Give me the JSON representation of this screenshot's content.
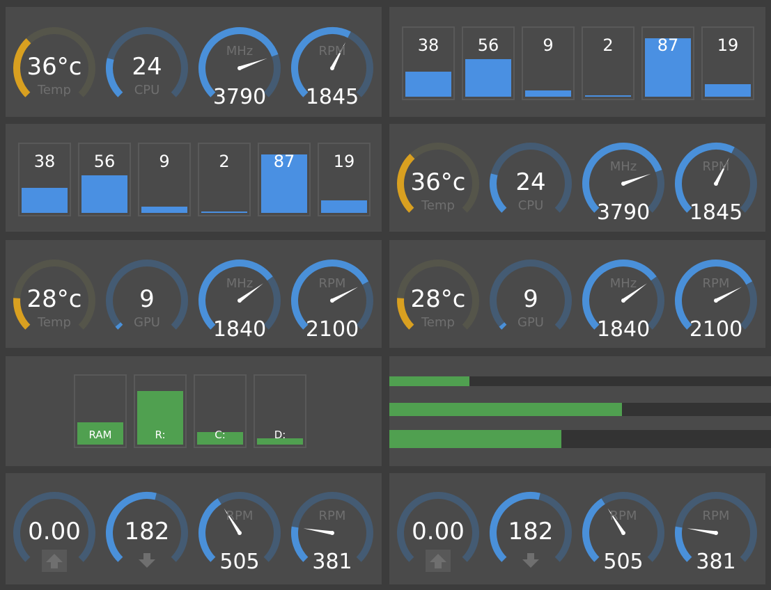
{
  "colors": {
    "arc_blue": "#4a90d9",
    "arc_track": "#445b73",
    "arc_temp": "#d9a020",
    "arc_temp_track": "#55554a",
    "bar_blue": "#4a90e2",
    "bar_green": "#50a050",
    "track_dark": "#333333",
    "panel_bg": "#4a4a4a",
    "page_bg": "#3c3c3c"
  },
  "cpu_panel": {
    "temp": {
      "value": "36°c",
      "label": "Temp",
      "level": 0.34
    },
    "load": {
      "value": "24",
      "label": "CPU",
      "level": 0.22
    },
    "clock": {
      "value": "3790",
      "label": "MHz",
      "level": 0.76
    },
    "fan": {
      "value": "1845",
      "label": "RPM",
      "level": 0.6
    }
  },
  "gpu_panel": {
    "temp": {
      "value": "28°c",
      "label": "Temp",
      "level": 0.18
    },
    "load": {
      "value": "9",
      "label": "GPU",
      "level": 0.02
    },
    "clock": {
      "value": "1840",
      "label": "MHz",
      "level": 0.7
    },
    "fan": {
      "value": "2100",
      "label": "RPM",
      "level": 0.73
    }
  },
  "core_bars": [
    {
      "value": "38",
      "level": 0.38
    },
    {
      "value": "56",
      "level": 0.56
    },
    {
      "value": "9",
      "level": 0.09
    },
    {
      "value": "2",
      "level": 0.02
    },
    {
      "value": "87",
      "level": 0.87
    },
    {
      "value": "19",
      "level": 0.19
    }
  ],
  "memory_bars": [
    {
      "label": "RAM",
      "level": 0.33
    },
    {
      "label": "R:",
      "level": 0.8
    },
    {
      "label": "C:",
      "level": 0.19
    },
    {
      "label": "D:",
      "level": 0.09
    }
  ],
  "disk_bars": [
    {
      "level": 0.21
    },
    {
      "level": 0.61
    },
    {
      "level": 0.45
    }
  ],
  "net_panel": {
    "upload": {
      "value": "0.00",
      "icon": "upload-arrow-icon",
      "level": 0.0
    },
    "download": {
      "value": "182",
      "icon": "download-arrow-icon",
      "level": 0.55
    },
    "fan1": {
      "value": "505",
      "label": "RPM",
      "level": 0.38
    },
    "fan2": {
      "value": "381",
      "label": "RPM",
      "level": 0.2
    }
  }
}
